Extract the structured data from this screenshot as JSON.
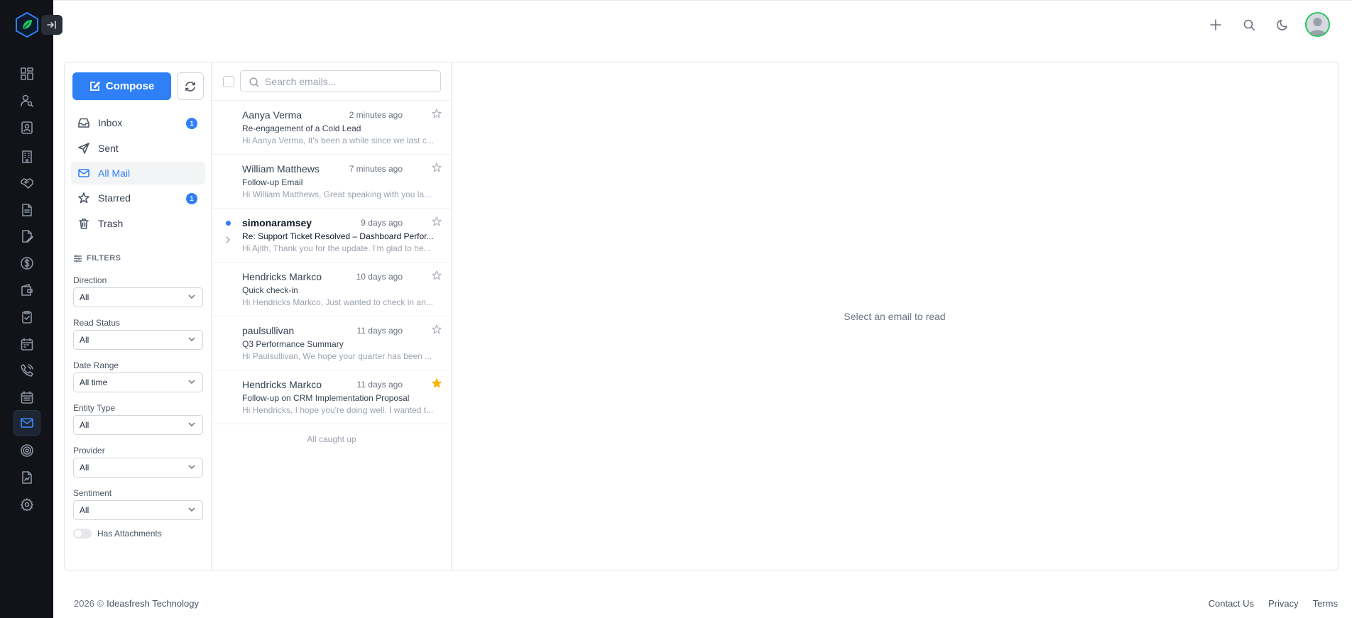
{
  "compose": {
    "label": "Compose"
  },
  "folders": [
    {
      "label": "Inbox",
      "badge": "1"
    },
    {
      "label": "Sent"
    },
    {
      "label": "All Mail"
    },
    {
      "label": "Starred",
      "badge": "1"
    },
    {
      "label": "Trash"
    }
  ],
  "filters": {
    "title": "FILTERS",
    "direction": {
      "label": "Direction",
      "value": "All"
    },
    "read_status": {
      "label": "Read Status",
      "value": "All"
    },
    "date_range": {
      "label": "Date Range",
      "value": "All time"
    },
    "entity_type": {
      "label": "Entity Type",
      "value": "All"
    },
    "provider": {
      "label": "Provider",
      "value": "All"
    },
    "sentiment": {
      "label": "Sentiment",
      "value": "All"
    },
    "attachments": {
      "label": "Has Attachments",
      "enabled": false
    }
  },
  "search": {
    "placeholder": "Search emails..."
  },
  "emails": [
    {
      "sender": "Aanya Verma",
      "time": "2 minutes ago",
      "subject": "Re-engagement of a Cold Lead",
      "preview": "Hi Aanya Verma, It's been a while since we last c...",
      "starred": false,
      "unread": false
    },
    {
      "sender": "William Matthews",
      "time": "7 minutes ago",
      "subject": "Follow-up Email",
      "preview": "Hi William Matthews, Great speaking with you las...",
      "starred": false,
      "unread": false
    },
    {
      "sender": "simonaramsey",
      "time": "9 days ago",
      "subject": "Re: Support Ticket Resolved – Dashboard Perfor...",
      "preview": "Hi Ajith, Thank you for the update. I'm glad to he...",
      "starred": false,
      "unread": true
    },
    {
      "sender": "Hendricks Markco",
      "time": "10 days ago",
      "subject": "Quick check-in",
      "preview": "Hi Hendricks Markco, Just wanted to check in an...",
      "starred": false,
      "unread": false
    },
    {
      "sender": "paulsullivan",
      "time": "11 days ago",
      "subject": "Q3 Performance Summary",
      "preview": "Hi Paulsullivan, We hope your quarter has been ...",
      "starred": false,
      "unread": false
    },
    {
      "sender": "Hendricks Markco",
      "time": "11 days ago",
      "subject": "Follow-up on CRM Implementation Proposal",
      "preview": "Hi Hendricks, I hope you're doing well. I wanted t...",
      "starred": true,
      "unread": false
    }
  ],
  "list_end": "All caught up",
  "reader": {
    "empty": "Select an email to read"
  },
  "footer": {
    "copyright": "2026 ©",
    "company": "Ideasfresh Technology",
    "links": [
      "Contact Us",
      "Privacy",
      "Terms"
    ]
  },
  "colors": {
    "accent": "#2f7ff7",
    "rail": "#111318",
    "star": "#f5b700"
  },
  "rail_icons": [
    "dashboard-icon",
    "user-search-icon",
    "contact-card-icon",
    "building-icon",
    "handshake-icon",
    "document-icon",
    "edit-document-icon",
    "dollar-icon",
    "wallet-icon",
    "clipboard-check-icon",
    "calendar-icon",
    "phone-icon",
    "calendar-grid-icon",
    "mail-icon",
    "target-icon",
    "report-icon",
    "settings-icon"
  ]
}
